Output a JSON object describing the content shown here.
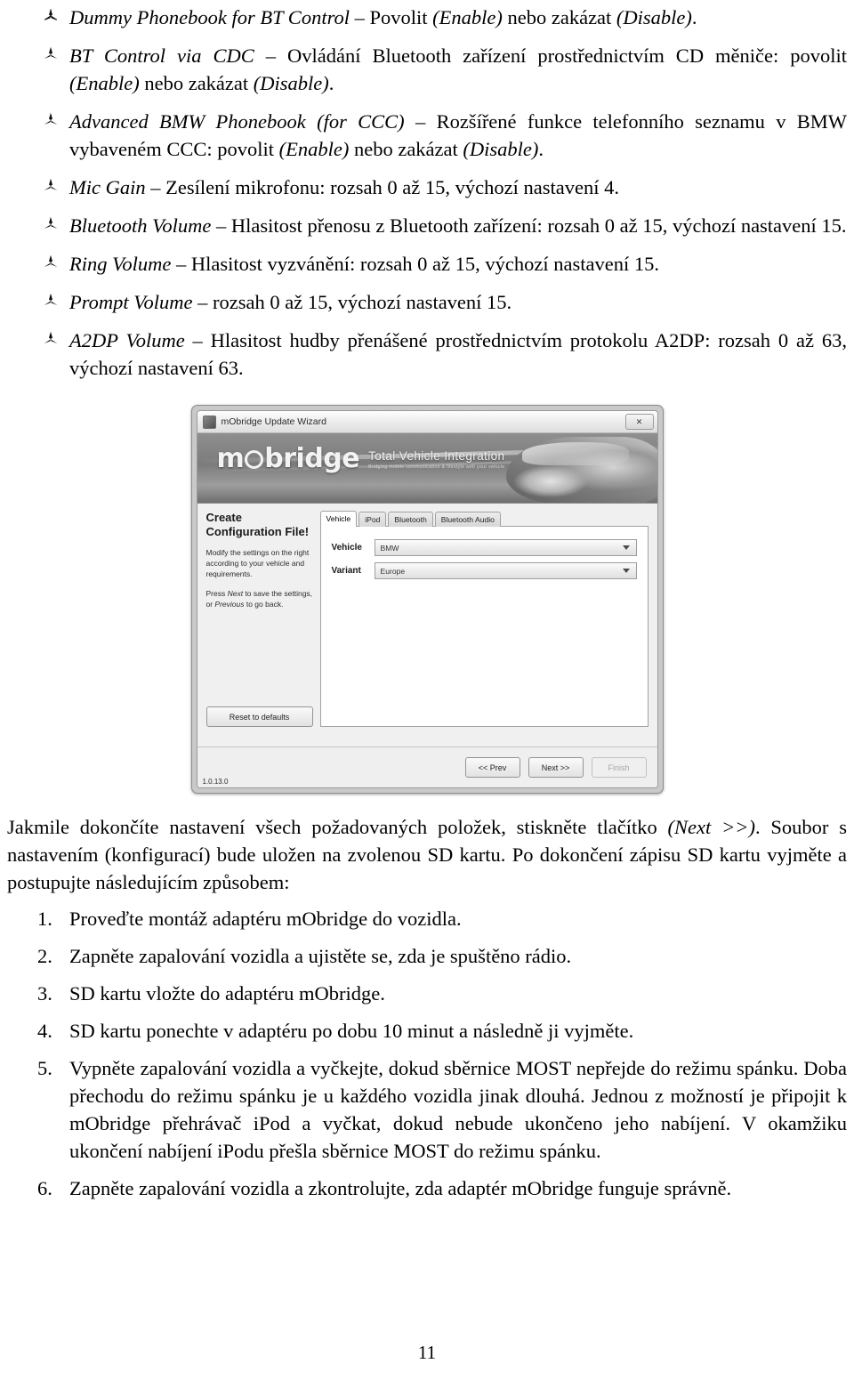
{
  "bullets": [
    {
      "term": "Dummy Phonebook for BT Control",
      "dash": " – ",
      "body_pre": "Povolit ",
      "en1": "(Enable)",
      "body_mid": " nebo zakázat ",
      "en2": "(Disable)",
      "body_post": "."
    },
    {
      "term": "BT Control via CDC",
      "dash": " – ",
      "body_pre": "Ovládání Bluetooth zařízení prostřednictvím CD měniče: povolit ",
      "en1": "(Enable)",
      "body_mid": " nebo zakázat ",
      "en2": "(Disable)",
      "body_post": "."
    },
    {
      "term": "Advanced BMW Phonebook (for CCC)",
      "dash": " – ",
      "body_pre": "Rozšířené funkce telefonního seznamu v BMW vybaveném CCC: povolit ",
      "en1": "(Enable)",
      "body_mid": " nebo zakázat ",
      "en2": "(Disable)",
      "body_post": "."
    },
    {
      "term": "Mic Gain",
      "dash": " – ",
      "body_pre": "Zesílení mikrofonu: rozsah 0 až 15, výchozí nastavení 4.",
      "en1": "",
      "body_mid": "",
      "en2": "",
      "body_post": ""
    },
    {
      "term": "Bluetooth Volume",
      "dash": " – ",
      "body_pre": "Hlasitost přenosu z Bluetooth zařízení: rozsah 0 až 15, výchozí nastavení 15.",
      "en1": "",
      "body_mid": "",
      "en2": "",
      "body_post": ""
    },
    {
      "term": "Ring Volume",
      "dash": " – ",
      "body_pre": "Hlasitost vyzvánění: rozsah 0 až 15, výchozí nastavení 15.",
      "en1": "",
      "body_mid": "",
      "en2": "",
      "body_post": ""
    },
    {
      "term": "Prompt Volume",
      "dash": " – ",
      "body_pre": "rozsah 0 až 15, výchozí nastavení 15.",
      "en1": "",
      "body_mid": "",
      "en2": "",
      "body_post": ""
    },
    {
      "term": "A2DP Volume",
      "dash": " – ",
      "body_pre": "Hlasitost hudby přenášené prostřednictvím protokolu A2DP: rozsah 0 až 63, výchozí nastavení 63.",
      "en1": "",
      "body_mid": "",
      "en2": "",
      "body_post": ""
    }
  ],
  "screenshot": {
    "window_title": "mObridge Update Wizard",
    "close_label": "✕",
    "banner": {
      "logo_part1": "m",
      "logo_part2": "bridge",
      "tagline": "Total Vehicle Integration",
      "tagline_sub": "Bridging mobile communication & lifestyle with your vehicle"
    },
    "left_pane": {
      "title_line1": "Create",
      "title_line2": "Configuration File!",
      "para1": "Modify the settings on the right according to your vehicle and requirements.",
      "para2_pre": "Press ",
      "para2_em1": "Next",
      "para2_mid": " to save the settings, or ",
      "para2_em2": "Previous",
      "para2_post": " to go back.",
      "reset_button": "Reset to defaults"
    },
    "tabs": [
      {
        "label": "Vehicle",
        "active": true
      },
      {
        "label": "iPod",
        "active": false
      },
      {
        "label": "Bluetooth",
        "active": false
      },
      {
        "label": "Bluetooth Audio",
        "active": false
      }
    ],
    "fields": [
      {
        "label": "Vehicle",
        "value": "BMW"
      },
      {
        "label": "Variant",
        "value": "Europe"
      }
    ],
    "footer": {
      "prev": "<< Prev",
      "next": "Next >>",
      "finish": "Finish",
      "version": "1.0.13.0"
    }
  },
  "paragraph": {
    "pre": "Jakmile dokončíte nastavení všech požadovaných položek, stiskněte tlačítko ",
    "em": "(Next >>)",
    "post": ". Soubor s nastavením (konfigurací) bude uložen na zvolenou SD kartu. Po dokončení zápisu SD kartu vyjměte a postupujte následujícím způsobem:"
  },
  "steps": [
    {
      "num": "1.",
      "text": "Proveďte montáž adaptéru mObridge do vozidla."
    },
    {
      "num": "2.",
      "text": "Zapněte zapalování vozidla a ujistěte se, zda je spuštěno rádio."
    },
    {
      "num": "3.",
      "text": "SD kartu vložte do adaptéru mObridge."
    },
    {
      "num": "4.",
      "text": "SD kartu ponechte v adaptéru po dobu 10 minut a následně ji vyjměte."
    },
    {
      "num": "5.",
      "text": "Vypněte zapalování vozidla a vyčkejte, dokud sběrnice MOST nepřejde do režimu spánku. Doba přechodu do režimu spánku je u každého vozidla jinak dlouhá. Jednou z možností je připojit k mObridge přehrávač iPod a vyčkat, dokud nebude ukončeno jeho nabíjení. V okamžiku ukončení nabíjení iPodu přešla sběrnice MOST do režimu spánku."
    },
    {
      "num": "6.",
      "text": "Zapněte zapalování vozidla a zkontrolujte, zda adaptér mObridge funguje správně."
    }
  ],
  "page_number": "11"
}
